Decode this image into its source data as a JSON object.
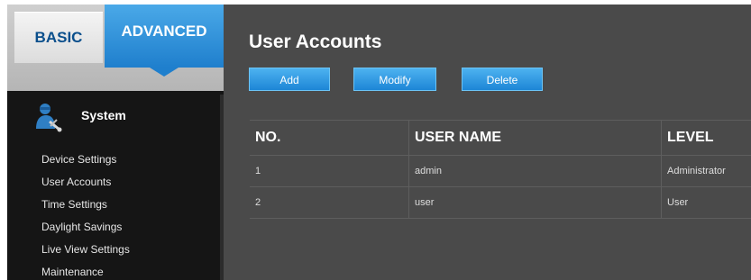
{
  "tabs": {
    "basic": "BASIC",
    "advanced": "ADVANCED"
  },
  "sidebar": {
    "section_title": "System",
    "section_icon": "technician-icon",
    "items": [
      {
        "label": "Device Settings"
      },
      {
        "label": "User Accounts"
      },
      {
        "label": "Time Settings"
      },
      {
        "label": "Daylight Savings"
      },
      {
        "label": "Live View Settings"
      },
      {
        "label": "Maintenance"
      }
    ]
  },
  "main": {
    "title": "User Accounts",
    "buttons": {
      "add": "Add",
      "modify": "Modify",
      "delete": "Delete"
    },
    "table": {
      "columns": [
        "NO.",
        "USER NAME",
        "LEVEL"
      ],
      "rows": [
        {
          "no": "1",
          "user_name": "admin",
          "level": "Administrator"
        },
        {
          "no": "2",
          "user_name": "user",
          "level": "User"
        }
      ]
    }
  },
  "colors": {
    "accent": "#2a8ed9",
    "sidebar_bg": "#151515",
    "content_bg": "#4a4a4a"
  }
}
